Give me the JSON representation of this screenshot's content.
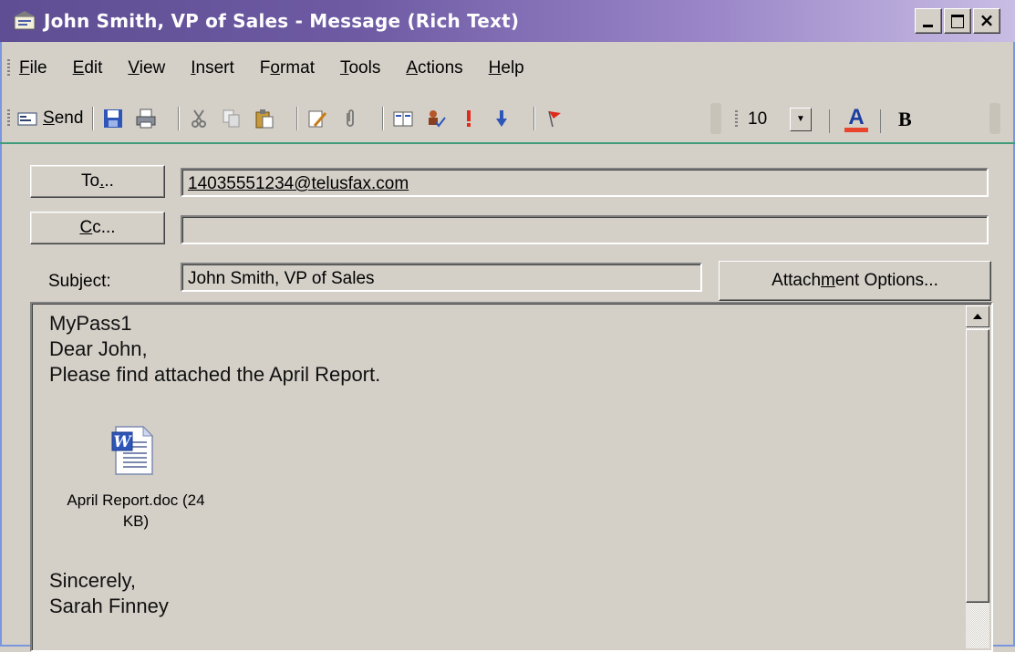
{
  "window": {
    "title": "John Smith, VP of Sales - Message (Rich Text)"
  },
  "menu": {
    "items": [
      {
        "u": "F",
        "rest": "ile"
      },
      {
        "u": "E",
        "rest": "dit"
      },
      {
        "u": "V",
        "rest": "iew"
      },
      {
        "u": "I",
        "rest": "nsert"
      },
      {
        "pre": "F",
        "u": "o",
        "rest": "rmat"
      },
      {
        "u": "T",
        "rest": "ools"
      },
      {
        "u": "A",
        "rest": "ctions"
      },
      {
        "u": "H",
        "rest": "elp"
      }
    ]
  },
  "toolbar": {
    "send_u": "S",
    "send_rest": "end",
    "font_size": "10",
    "font_color_glyph": "A",
    "bold_glyph": "B"
  },
  "addressing": {
    "to_label_pre": "To",
    "to_label_u": ".",
    "to_label_post": "..",
    "to_value": "14035551234@telusfax.com",
    "cc_label_u": "C",
    "cc_label_post": "c...",
    "cc_value": "",
    "subject_label_pre": "Sub",
    "subject_label_u": "j",
    "subject_label_post": "ect:",
    "subject_value": "John Smith, VP of Sales",
    "attach_options_pre": "Attach",
    "attach_options_u": "m",
    "attach_options_post": "ent Options..."
  },
  "message": {
    "line1": "MyPass1",
    "line2": "Dear John,",
    "line3": "Please find attached the April Report.",
    "attachment_name_line1": "April Report.doc (24",
    "attachment_name_line2": "KB)",
    "closing": "Sincerely,",
    "signature": "Sarah Finney"
  },
  "colors": {
    "title_gradient_start": "#5f4e93",
    "chrome": "#d4d0c8",
    "font_color_swatch": "#e8452c"
  }
}
